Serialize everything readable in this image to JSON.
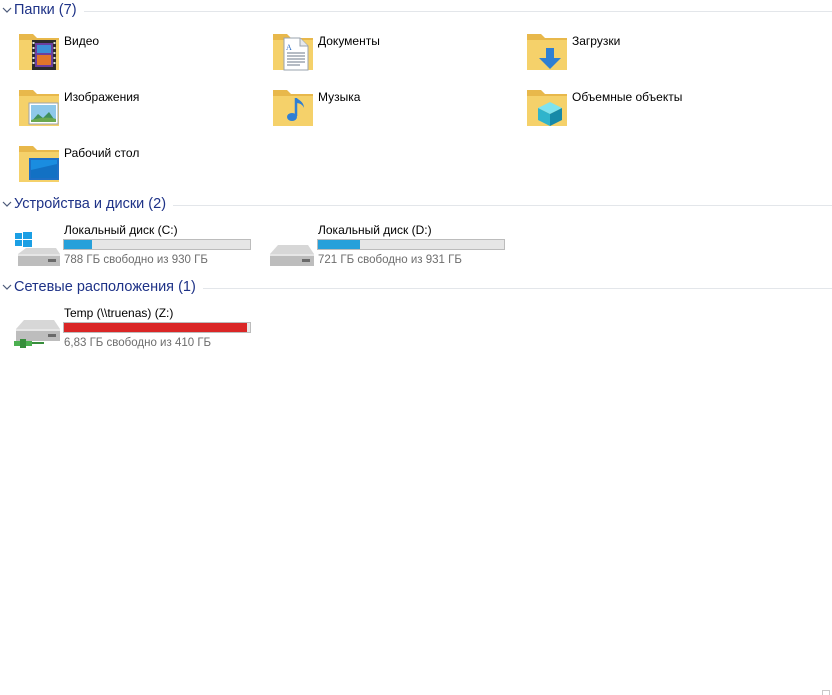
{
  "groups": {
    "folders": {
      "title": "Папки (7)"
    },
    "devices": {
      "title": "Устройства и диски (2)"
    },
    "network": {
      "title": "Сетевые расположения (1)"
    }
  },
  "folders": [
    {
      "label": "Видео",
      "icon": "video-folder-icon"
    },
    {
      "label": "Документы",
      "icon": "documents-folder-icon"
    },
    {
      "label": "Загрузки",
      "icon": "downloads-folder-icon"
    },
    {
      "label": "Изображения",
      "icon": "pictures-folder-icon"
    },
    {
      "label": "Музыка",
      "icon": "music-folder-icon"
    },
    {
      "label": "Объемные объекты",
      "icon": "3d-objects-folder-icon"
    },
    {
      "label": "Рабочий стол",
      "icon": "desktop-folder-icon"
    }
  ],
  "drives": [
    {
      "label": "Локальный диск (C:)",
      "free": "788 ГБ свободно из 930 ГБ",
      "used_fraction": 0.153,
      "color": "#26a0da",
      "icon": "windows-drive-icon"
    },
    {
      "label": "Локальный диск (D:)",
      "free": "721 ГБ свободно из 931 ГБ",
      "used_fraction": 0.226,
      "color": "#26a0da",
      "icon": "hard-drive-icon"
    }
  ],
  "network_drives": [
    {
      "label": "Temp (\\\\truenas) (Z:)",
      "free": "6,83 ГБ свободно из 410 ГБ",
      "used_fraction": 0.983,
      "color": "#da2626",
      "icon": "network-drive-icon"
    }
  ]
}
